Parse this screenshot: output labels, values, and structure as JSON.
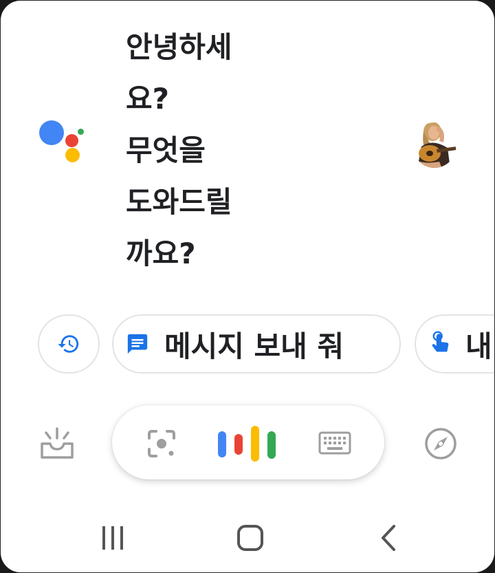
{
  "greeting": {
    "lines": [
      "안녕하세",
      "요?",
      "무엇을",
      "도와드릴",
      "까요?"
    ]
  },
  "chips": {
    "history_icon": "history-icon",
    "message_icon": "message-icon",
    "message_label": "메시지 보내 줘",
    "third_icon": "touch-hand-icon",
    "third_label": "내"
  },
  "bottom_bar": {
    "left_icon": "updates-tray-icon",
    "lens_icon": "lens-icon",
    "mic_icon": "google-mic-bars-icon",
    "keyboard_icon": "keyboard-icon",
    "explore_icon": "compass-icon"
  },
  "nav": {
    "recents_icon": "recents-icon",
    "home_icon": "home-icon",
    "back_icon": "back-icon"
  },
  "colors": {
    "blue": "#4285F4",
    "red": "#EA4335",
    "yellow": "#FBBC04",
    "green": "#34A853",
    "text": "#202124",
    "icon_gray": "#9e9e9e"
  }
}
